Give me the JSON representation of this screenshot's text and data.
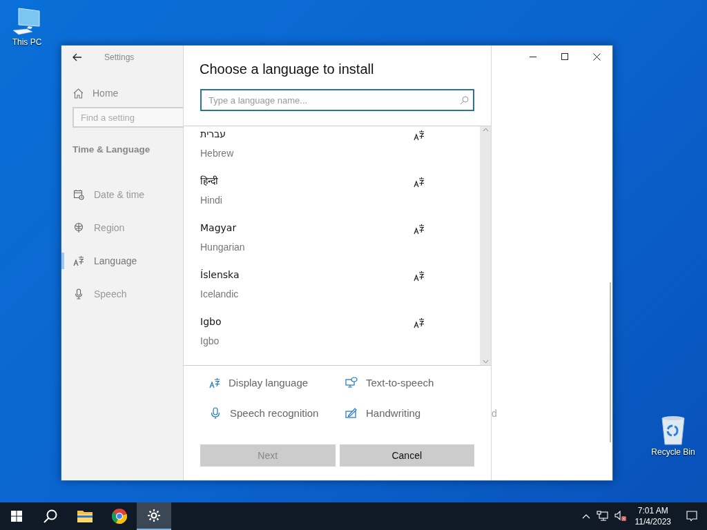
{
  "desktop_icons": [
    {
      "label": "This PC",
      "kind": "pc"
    },
    {
      "label": "Recycle Bin",
      "kind": "bin"
    }
  ],
  "window": {
    "title": "Settings",
    "faded_text": "d"
  },
  "sidebar": {
    "home": "Home",
    "search": {
      "placeholder": "Find a setting"
    },
    "section": "Time & Language",
    "items": [
      {
        "label": "Date & time",
        "kind": "calendar",
        "selected": false
      },
      {
        "label": "Region",
        "kind": "globe",
        "selected": false
      },
      {
        "label": "Language",
        "kind": "language",
        "selected": true
      },
      {
        "label": "Speech",
        "kind": "mic",
        "selected": false
      }
    ]
  },
  "dialog": {
    "title": "Choose a language to install",
    "search": {
      "placeholder": "Type a language name..."
    },
    "languages": [
      {
        "native": "עברית",
        "english": "Hebrew"
      },
      {
        "native": "हिन्दी",
        "english": "Hindi"
      },
      {
        "native": "Magyar",
        "english": "Hungarian"
      },
      {
        "native": "Íslenska",
        "english": "Icelandic"
      },
      {
        "native": "Igbo",
        "english": "Igbo"
      }
    ],
    "features": [
      {
        "label": "Display language",
        "kind": "display"
      },
      {
        "label": "Text-to-speech",
        "kind": "tts"
      },
      {
        "label": "Speech recognition",
        "kind": "mic"
      },
      {
        "label": "Handwriting",
        "kind": "pen"
      }
    ],
    "buttons": [
      {
        "label": "Next",
        "disabled": true
      },
      {
        "label": "Cancel",
        "disabled": false
      }
    ]
  },
  "taskbar": {
    "apps": [
      {
        "kind": "search",
        "selected": false
      },
      {
        "kind": "folder",
        "selected": false
      },
      {
        "kind": "browser",
        "selected": false
      },
      {
        "kind": "settings",
        "selected": true
      }
    ],
    "time": "7:01 AM",
    "date": "11/4/2023"
  }
}
